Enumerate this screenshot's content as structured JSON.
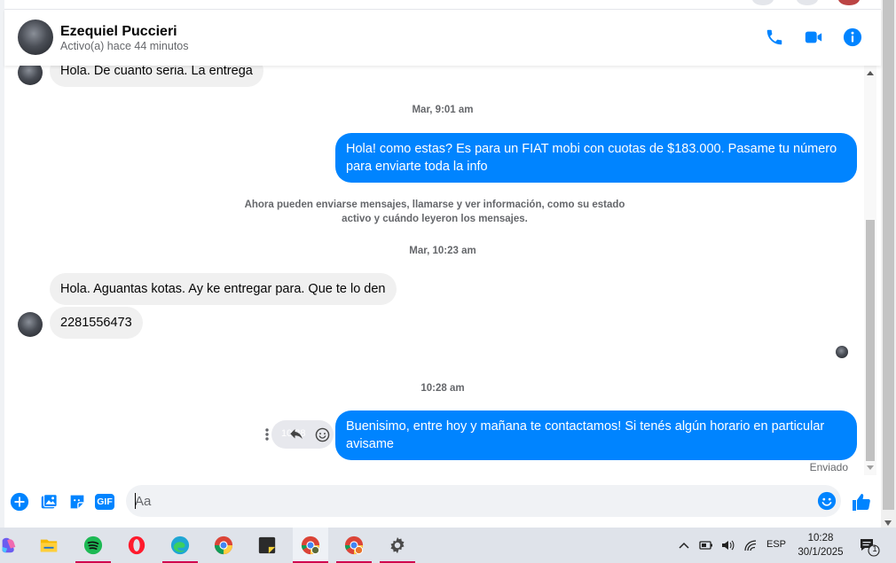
{
  "header": {
    "name": "Ezequiel Puccieri",
    "status": "Activo(a) hace 44 minutos"
  },
  "messages": {
    "msg1": "Hola. De cuanto seria. La entrega",
    "ts1": "Mar, 9:01 am",
    "msg2": "Hola! como estas? Es para un FIAT mobi con cuotas de $183.000. Pasame tu número para enviarte toda la info",
    "system_line1": "Ahora pueden enviarse mensajes, llamarse y ver información, como su estado",
    "system_line2": "activo y cuándo leyeron los mensajes.",
    "ts2": "Mar, 10:23 am",
    "msg3": "Hola. Aguantas kotas. Ay ke entregar para. Que te lo den",
    "msg4": "2281556473",
    "ts3": "10:28 am",
    "msg5": "Buenisimo, entre hoy y mañana te contactamos! Si tenés algún horario en particular avisame",
    "hover_time": "10:28",
    "sent_status": "Enviado"
  },
  "composer": {
    "placeholder": "Aa",
    "gif_label": "GIF"
  },
  "taskbar": {
    "apps": [
      "copilot",
      "file-explorer",
      "spotify",
      "opera",
      "edge",
      "chrome",
      "sticky-notes",
      "chrome-profile-1",
      "chrome-profile-2",
      "settings"
    ],
    "language": "ESP",
    "time": "10:28",
    "date": "30/1/2025",
    "notification_count": "1"
  },
  "colors": {
    "accent": "#0084ff",
    "incoming_bubble": "#f0f0f0"
  }
}
